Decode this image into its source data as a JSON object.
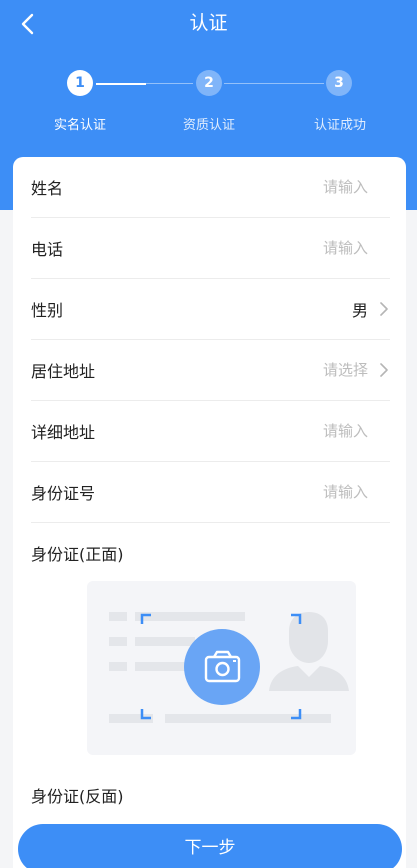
{
  "header": {
    "title": "认证",
    "back_icon": "chevron-left-icon",
    "background_color": "#3d8ef6"
  },
  "steps": [
    {
      "number": "1",
      "label": "实名认证",
      "state": "active"
    },
    {
      "number": "2",
      "label": "资质认证",
      "state": "inactive"
    },
    {
      "number": "3",
      "label": "认证成功",
      "state": "inactive"
    }
  ],
  "form": {
    "rows": [
      {
        "label": "姓名",
        "value": "请输入",
        "placeholder": true,
        "chevron": false
      },
      {
        "label": "电话",
        "value": "请输入",
        "placeholder": true,
        "chevron": false
      },
      {
        "label": "性别",
        "value": "男",
        "placeholder": false,
        "chevron": true
      },
      {
        "label": "居住地址",
        "value": "请选择",
        "placeholder": true,
        "chevron": true
      },
      {
        "label": "详细地址",
        "value": "请输入",
        "placeholder": true,
        "chevron": false
      },
      {
        "label": "身份证号",
        "value": "请输入",
        "placeholder": true,
        "chevron": false
      }
    ],
    "id_front_title": "身份证(正面)",
    "id_back_title": "身份证(反面)",
    "camera_icon": "camera-icon"
  },
  "footer": {
    "next_label": "下一步"
  }
}
